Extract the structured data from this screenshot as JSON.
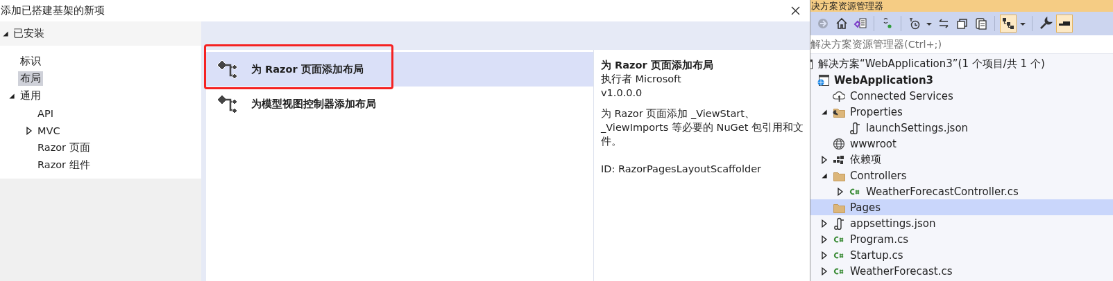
{
  "dialog": {
    "title": "添加已搭建基架的新项",
    "categories": [
      {
        "label": "已安装",
        "expanded": true,
        "selected": false,
        "children": [
          {
            "label": "标识",
            "selected": false
          },
          {
            "label": "布局",
            "selected": true
          },
          {
            "label": "通用",
            "expanded": true,
            "selected": false,
            "children": [
              {
                "label": "API",
                "selected": false
              },
              {
                "label": "MVC",
                "expanded": false,
                "selected": false
              },
              {
                "label": "Razor 页面",
                "selected": false
              },
              {
                "label": "Razor 组件",
                "selected": false
              }
            ]
          }
        ]
      }
    ],
    "templates": [
      {
        "title": "为 Razor 页面添加布局",
        "selected": true,
        "highlighted": true
      },
      {
        "title": "为模型视图控制器添加布局",
        "selected": false,
        "highlighted": false
      }
    ],
    "details": {
      "title": "为 Razor 页面添加布局",
      "author": "执行者 Microsoft",
      "version": "v1.0.0.0",
      "description": "为 Razor 页面添加 _ViewStart、_ViewImports 等必要的 NuGet 包引用和文件。",
      "id": "ID: RazorPagesLayoutScaffolder"
    }
  },
  "solution_explorer": {
    "title": "决方案资源管理器",
    "toolbar": [
      {
        "on": false,
        "disabled": true
      },
      {
        "on": false,
        "disabled": false
      },
      {
        "on": false,
        "disabled": false
      },
      {
        "on": false,
        "disabled": false
      },
      {
        "on": false,
        "disabled": false
      },
      {
        "on": false,
        "disabled": false
      },
      {
        "on": false,
        "disabled": false
      },
      {
        "on": false,
        "disabled": false
      },
      {
        "on": false,
        "disabled": false
      },
      {
        "on": true,
        "disabled": false
      },
      {
        "on": false,
        "disabled": false
      },
      {
        "on": false,
        "disabled": false
      },
      {
        "on": true,
        "disabled": false
      }
    ],
    "search": {
      "placeholder": "解决方案资源管理器(Ctrl+;)"
    },
    "tree": [
      {
        "label": "解决方案“WebApplication3”(1 个项目/共 1 个)",
        "kind": "solution",
        "selected": false,
        "startup": false,
        "children": [
          {
            "label": "WebApplication3",
            "kind": "web-project",
            "selected": false,
            "startup": true,
            "children": [
              {
                "label": "Connected Services",
                "kind": "connected",
                "selected": false,
                "startup": false
              },
              {
                "label": "Properties",
                "kind": "settings-folder",
                "expanded": true,
                "selected": false,
                "startup": false,
                "children": [
                  {
                    "label": "launchSettings.json",
                    "kind": "json",
                    "selected": false,
                    "startup": false
                  }
                ]
              },
              {
                "label": "wwwroot",
                "kind": "globe",
                "selected": false,
                "startup": false
              },
              {
                "label": "依赖项",
                "kind": "dependencies",
                "expanded": false,
                "selected": false,
                "startup": false
              },
              {
                "label": "Controllers",
                "kind": "folder",
                "expanded": true,
                "selected": false,
                "startup": false,
                "children": [
                  {
                    "label": "WeatherForecastController.cs",
                    "kind": "csharp",
                    "expanded": false,
                    "selected": false,
                    "startup": false
                  }
                ]
              },
              {
                "label": "Pages",
                "kind": "folder",
                "selected": true,
                "startup": false
              },
              {
                "label": "appsettings.json",
                "kind": "json",
                "expanded": false,
                "selected": false,
                "startup": false
              },
              {
                "label": "Program.cs",
                "kind": "csharp",
                "expanded": false,
                "selected": false,
                "startup": false
              },
              {
                "label": "Startup.cs",
                "kind": "csharp",
                "expanded": false,
                "selected": false,
                "startup": false
              },
              {
                "label": "WeatherForecast.cs",
                "kind": "csharp",
                "expanded": false,
                "selected": false,
                "startup": false
              }
            ]
          }
        ]
      }
    ]
  }
}
